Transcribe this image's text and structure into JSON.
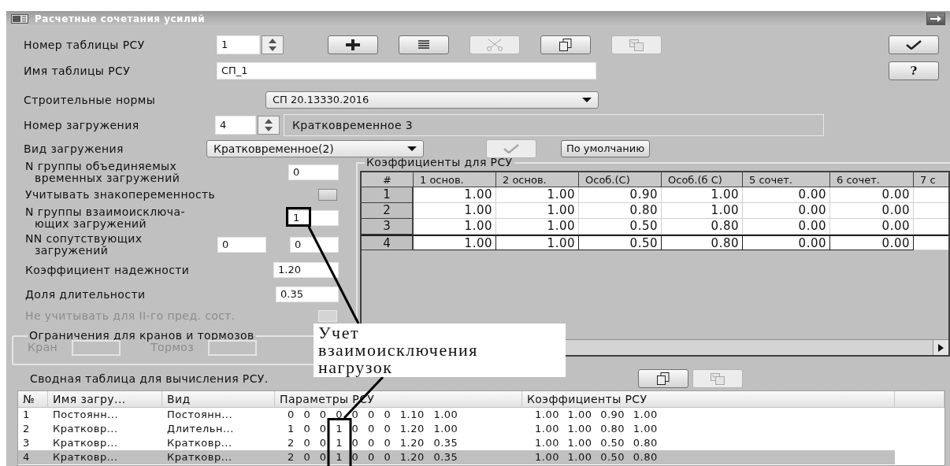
{
  "window": {
    "title": "Расчетные сочетания усилий"
  },
  "table_number": {
    "label": "Номер таблицы РСУ",
    "value": "1"
  },
  "toolbar": [
    {
      "kind": "add",
      "disabled": false
    },
    {
      "kind": "list",
      "disabled": false
    },
    {
      "kind": "cut",
      "disabled": true
    },
    {
      "kind": "copy",
      "disabled": false
    },
    {
      "kind": "paste",
      "disabled": true
    }
  ],
  "side_buttons": [
    {
      "kind": "apply"
    },
    {
      "kind": "help",
      "label": "?"
    }
  ],
  "table_name": {
    "label": "Имя таблицы РСУ",
    "value": "СП_1"
  },
  "norms": {
    "label": "Строительные нормы",
    "value": "СП 20.13330.2016"
  },
  "load_number": {
    "label": "Номер загружения",
    "value": "4",
    "load_name": "Кратковременное 3"
  },
  "load_type": {
    "label": "Вид загружения",
    "value": "Кратковременное(2)",
    "apply_disabled": true,
    "default_button": "По умолчанию"
  },
  "params": [
    {
      "kind": "field",
      "label_lines": [
        "N группы объединяемых",
        "временных загружений"
      ],
      "values": [
        "0"
      ]
    },
    {
      "kind": "checkbox",
      "label_lines": [
        "Учитывать знакопеременность"
      ],
      "checked": false,
      "disabled": false
    },
    {
      "kind": "field",
      "label_lines": [
        "N группы взаимоисключа-",
        "ющих загружений"
      ],
      "values": [
        "1"
      ]
    },
    {
      "kind": "field",
      "label_lines": [
        "NN сопутствующих",
        "загружений"
      ],
      "values": [
        "0",
        "0"
      ]
    },
    {
      "kind": "field",
      "label_lines": [
        "Коэффициент надежности"
      ],
      "values": [
        "1.20"
      ]
    },
    {
      "kind": "field",
      "label_lines": [
        "Доля длительности"
      ],
      "values": [
        "0.35"
      ]
    },
    {
      "kind": "checkbox",
      "label_lines": [
        "Не учитывать для II-го пред. сост."
      ],
      "checked": false,
      "disabled": true
    }
  ],
  "crane_group": {
    "title": "Ограничения для кранов и тормозов",
    "fields": [
      {
        "label": "Кран",
        "disabled": true
      },
      {
        "label": "Тормоз",
        "disabled": true
      }
    ]
  },
  "coef_table": {
    "title": "Коэффициенты для РСУ",
    "columns": [
      "#",
      "1 основ.",
      "2 основ.",
      "Особ.(С)",
      "Особ.(б С)",
      "5 сочет.",
      "6 сочет.",
      "7 с"
    ],
    "rows": [
      {
        "cells": [
          "1",
          "1.00",
          "1.00",
          "0.90",
          "1.00",
          "0.00",
          "0.00"
        ],
        "selected": false
      },
      {
        "cells": [
          "2",
          "1.00",
          "1.00",
          "0.80",
          "1.00",
          "0.00",
          "0.00"
        ],
        "selected": false
      },
      {
        "cells": [
          "3",
          "1.00",
          "1.00",
          "0.50",
          "0.80",
          "0.00",
          "0.00"
        ],
        "selected": false
      },
      {
        "cells": [
          "4",
          "1.00",
          "1.00",
          "0.50",
          "0.80",
          "0.00",
          "0.00"
        ],
        "selected": true
      }
    ]
  },
  "summary": {
    "title": "Сводная таблица для вычисления РСУ.",
    "toolbar": [
      {
        "kind": "copy",
        "disabled": false
      },
      {
        "kind": "paste",
        "disabled": true
      }
    ],
    "columns": [
      "№",
      "Имя загру...",
      "Вид",
      "Параметры РСУ",
      "Коэффициенты РСУ"
    ],
    "rows": [
      {
        "cells": [
          "1",
          "Постоянн...",
          "Постоянн...",
          "0 0 0 0 0 0 0 1.10 1.00",
          "1.00 1.00 0.90 1.00"
        ],
        "selected": false
      },
      {
        "cells": [
          "2",
          "Кратковр...",
          "Длительн...",
          "1 0 0 1 0 0 0 1.20 1.00",
          "1.00 1.00 0.80 1.00"
        ],
        "selected": false
      },
      {
        "cells": [
          "3",
          "Кратковр...",
          "Кратковр...",
          "2 0 0 1 0 0 0 1.20 0.35",
          "1.00 1.00 0.50 0.80"
        ],
        "selected": false
      },
      {
        "cells": [
          "4",
          "Кратковр...",
          "Кратковр...",
          "2 0 0 1 0 0 0 1.20 0.35",
          "1.00 1.00 0.50 0.80"
        ],
        "selected": true
      }
    ]
  },
  "annotation": {
    "text": "Учет взаимоисключения нагрузок"
  }
}
